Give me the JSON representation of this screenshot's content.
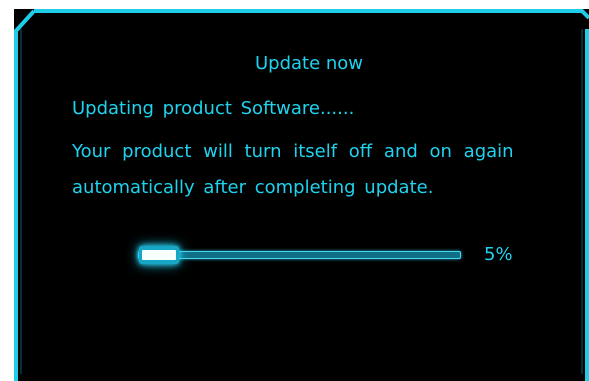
{
  "dialog": {
    "title": "Update now",
    "status": "Updating  product Software......",
    "message_line1": "Your product will turn itself off and on again",
    "message_line2": "automatically after completing  update."
  },
  "progress": {
    "value": 0.05,
    "label": "5%"
  },
  "colors": {
    "accent": "#1fd3ef",
    "background": "#000000",
    "track": "#0f6f86",
    "fill_core": "#f7ffff"
  }
}
